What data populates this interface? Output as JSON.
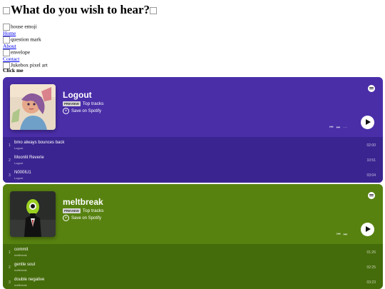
{
  "page": {
    "title": "What do you wish to hear?",
    "title_img_alt": "",
    "click_me": "Click me"
  },
  "nav": [
    {
      "img_alt": "house emoji",
      "link": "Home"
    },
    {
      "img_alt": "question mark",
      "link": "About"
    },
    {
      "img_alt": "envelope",
      "link": "Contact"
    }
  ],
  "jukebox_alt": "Jukebox pixel art",
  "embeds": [
    {
      "name": "Logout",
      "badge": "PREVIEW",
      "subtitle": "Top tracks",
      "save": "Save on Spotify",
      "color": "#4a2ea8",
      "tracks": [
        {
          "num": "1",
          "name": "bmo always bounces back",
          "artist": "Logout",
          "duration": "02:00"
        },
        {
          "num": "2",
          "name": "Moonlit Reverie",
          "artist": "Logout",
          "duration": "10:51"
        },
        {
          "num": "3",
          "name": "N000IU1",
          "artist": "Logout",
          "duration": "03:04"
        }
      ]
    },
    {
      "name": "meltbreak",
      "badge": "PREVIEW",
      "subtitle": "Top tracks",
      "save": "Save on Spotify",
      "color": "#578210",
      "tracks": [
        {
          "num": "1",
          "name": "commit",
          "artist": "meltbreak",
          "duration": "01:26"
        },
        {
          "num": "2",
          "name": "gentle soul",
          "artist": "meltbreak",
          "duration": "02:25"
        },
        {
          "num": "3",
          "name": "double negative",
          "artist": "meltbreak",
          "duration": "03:23"
        }
      ]
    }
  ]
}
